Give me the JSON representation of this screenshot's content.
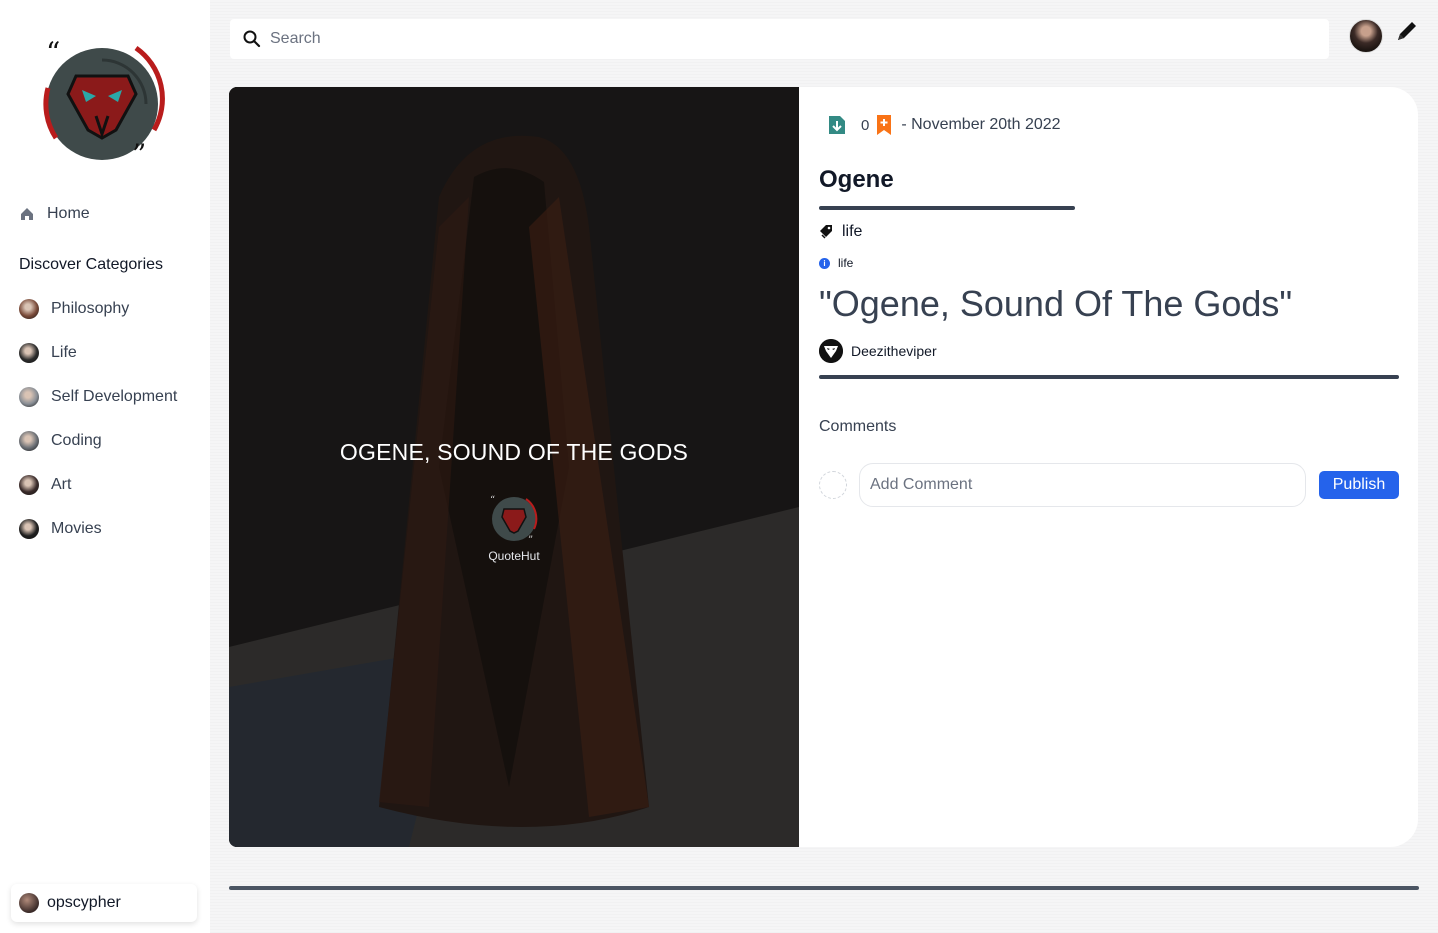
{
  "search": {
    "placeholder": "Search"
  },
  "sidebar": {
    "home_label": "Home",
    "section_title": "Discover Categories",
    "categories": [
      {
        "label": "Philosophy",
        "color": "#7a4b3a"
      },
      {
        "label": "Life",
        "color": "#2b2b2b"
      },
      {
        "label": "Self Development",
        "color": "#8a8f96"
      },
      {
        "label": "Coding",
        "color": "#6b6f75"
      },
      {
        "label": "Art",
        "color": "#3a2b2a"
      },
      {
        "label": "Movies",
        "color": "#1f1f1f"
      }
    ],
    "user": {
      "name": "opscypher"
    }
  },
  "post": {
    "overlay_text": "OGENE, SOUND OF THE GODS",
    "brand": "QuoteHut",
    "bookmark_count": "0",
    "date": "- November 20th 2022",
    "title": "Ogene",
    "category": "life",
    "tag": "life",
    "quote": "\"Ogene, Sound Of The Gods\"",
    "author": "Deezitheviper"
  },
  "comments": {
    "label": "Comments",
    "placeholder": "Add Comment",
    "publish_label": "Publish"
  },
  "colors": {
    "accent": "#2563eb",
    "bookmark": "#f97316",
    "download": "#0f766e",
    "logo_red": "#b91c1c"
  }
}
